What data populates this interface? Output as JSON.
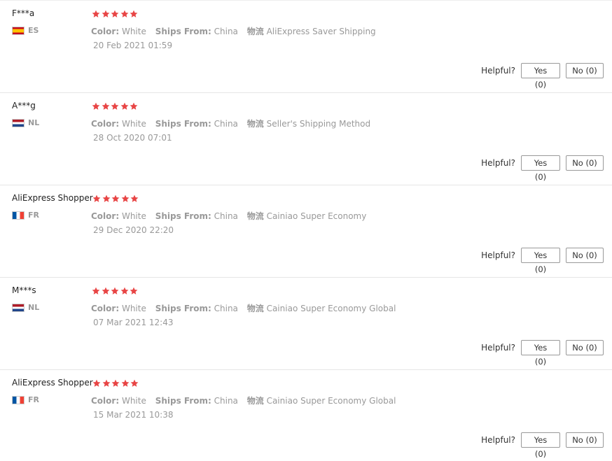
{
  "labels": {
    "color": "Color:",
    "ships_from": "Ships From:",
    "logistics": "物流",
    "helpful": "Helpful?",
    "yes": "Yes (0)",
    "no": "No (0)"
  },
  "colors": {
    "star": "#e84545",
    "muted_text": "#999999",
    "divider": "#e6e6e6"
  },
  "reviews": [
    {
      "user": "F***a",
      "country": "ES",
      "flag": "spain-flag",
      "rating": 5,
      "color": "White",
      "ships_from": "China",
      "logistics": "AliExpress Saver Shipping",
      "date": "20 Feb 2021 01:59"
    },
    {
      "user": "A***g",
      "country": "NL",
      "flag": "netherlands-flag",
      "rating": 5,
      "color": "White",
      "ships_from": "China",
      "logistics": "Seller's Shipping Method",
      "date": "28 Oct 2020 07:01"
    },
    {
      "user": "AliExpress Shopper",
      "country": "FR",
      "flag": "france-flag",
      "rating": 5,
      "color": "White",
      "ships_from": "China",
      "logistics": "Cainiao Super Economy",
      "date": "29 Dec 2020 22:20"
    },
    {
      "user": "M***s",
      "country": "NL",
      "flag": "netherlands-flag",
      "rating": 5,
      "color": "White",
      "ships_from": "China",
      "logistics": "Cainiao Super Economy Global",
      "date": "07 Mar 2021 12:43"
    },
    {
      "user": "AliExpress Shopper",
      "country": "FR",
      "flag": "france-flag",
      "rating": 5,
      "color": "White",
      "ships_from": "China",
      "logistics": "Cainiao Super Economy Global",
      "date": "15 Mar 2021 10:38"
    }
  ]
}
